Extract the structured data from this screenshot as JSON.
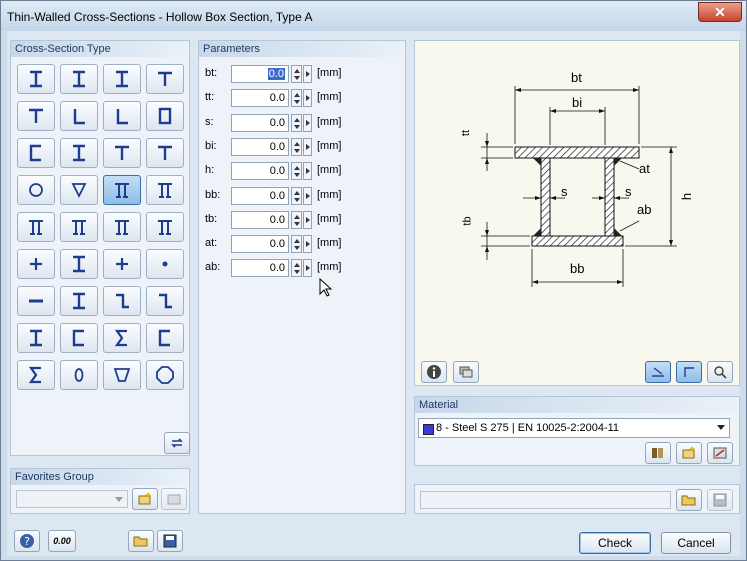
{
  "window": {
    "title": "Thin-Walled Cross-Sections - Hollow Box Section, Type A",
    "close_glyph": "✕"
  },
  "cross_section_type": {
    "header": "Cross-Section Type",
    "buttons": [
      "i-section",
      "i-section-tapered",
      "i-section-asym",
      "t-section-wide",
      "t-section",
      "angle-small",
      "angle",
      "box",
      "channel",
      "i-welded",
      "t-welded",
      "y-section",
      "circle",
      "triangle-down",
      "hollow-box-a",
      "hollow-box-b",
      "box-flanged-a",
      "box-flanged-b",
      "pi-section",
      "pi-section-b",
      "cross-i",
      "cross-i-b",
      "cross-plus",
      "point",
      "flat-bar",
      "i-double",
      "z-section",
      "z-section-b",
      "i-narrow",
      "c-section",
      "sigma-lip",
      "c-lip",
      "sigma",
      "zero-oval",
      "trapezoid",
      "polygon"
    ],
    "selected_index": 14
  },
  "favorites": {
    "header": "Favorites Group",
    "value": ""
  },
  "parameters": {
    "header": "Parameters",
    "rows": [
      {
        "label": "bt:",
        "value": "0.0",
        "unit": "[mm]",
        "selected": true
      },
      {
        "label": "tt:",
        "value": "0.0",
        "unit": "[mm]"
      },
      {
        "label": "s:",
        "value": "0.0",
        "unit": "[mm]"
      },
      {
        "label": "bi:",
        "value": "0.0",
        "unit": "[mm]"
      },
      {
        "label": "h:",
        "value": "0.0",
        "unit": "[mm]"
      },
      {
        "label": "bb:",
        "value": "0.0",
        "unit": "[mm]"
      },
      {
        "label": "tb:",
        "value": "0.0",
        "unit": "[mm]"
      },
      {
        "label": "at:",
        "value": "0.0",
        "unit": "[mm]"
      },
      {
        "label": "ab:",
        "value": "0.0",
        "unit": "[mm]"
      }
    ]
  },
  "diagram": {
    "labels": {
      "bt": "bt",
      "bi": "bi",
      "tt": "tt",
      "at": "at",
      "h": "h",
      "s_left": "s",
      "s_right": "s",
      "ab": "ab",
      "tb": "tb",
      "bb": "bb"
    }
  },
  "material": {
    "header": "Material",
    "value": "8 - Steel S 275 | EN 10025-2:2004-11",
    "swatch_color": "#3b3bd6"
  },
  "buttons": {
    "check": "Check",
    "cancel": "Cancel",
    "units_label": "0.00"
  },
  "colors": {
    "accent": "#3a6ea5",
    "panel_header": "#c7d8ea",
    "icon_blue": "#1e3d8f"
  }
}
